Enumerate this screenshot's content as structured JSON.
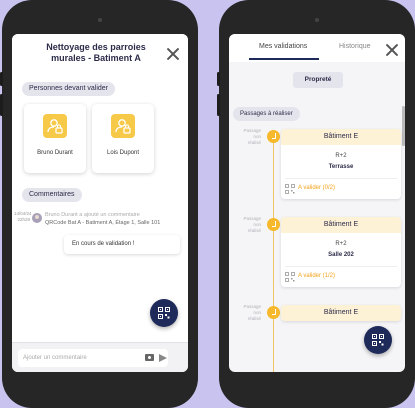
{
  "colors": {
    "background": "#c8c3ef",
    "navy": "#1e2a5a",
    "yellow": "#f7c948",
    "status_orange": "#f2a21b"
  },
  "left": {
    "title": "Nettoyage des parroies murales - Batiment A",
    "validators_heading": "Personnes devant valider",
    "validators": [
      {
        "name": "Bruno Durant",
        "icon": "user-lock-icon"
      },
      {
        "name": "Lois Dupont",
        "icon": "user-lock-icon"
      }
    ],
    "comments_heading": "Commentaires",
    "comment": {
      "date": "14/04/24",
      "time": "22h28",
      "meta": "Bruno Durant a ajouté un commentaire",
      "qr": "QRCode Bat A - Batiment A, Étage 1, Salle 101",
      "text": "En cours de validation !"
    },
    "input_placeholder": "Ajouter un commentaire"
  },
  "right": {
    "tabs": [
      "Mes validations",
      "Historique"
    ],
    "filter": "Propreté",
    "section": "Passages à réaliser",
    "timeline_label": [
      "Passage",
      "non",
      "réalisé"
    ],
    "passages": [
      {
        "building": "Bâtiment E",
        "floor": "R+2",
        "room": "Terrasse",
        "status": "A valider (0/2)"
      },
      {
        "building": "Bâtiment E",
        "floor": "R+2",
        "room": "Salle 202",
        "status": "A valider (1/2)"
      },
      {
        "building": "Bâtiment E"
      }
    ]
  }
}
